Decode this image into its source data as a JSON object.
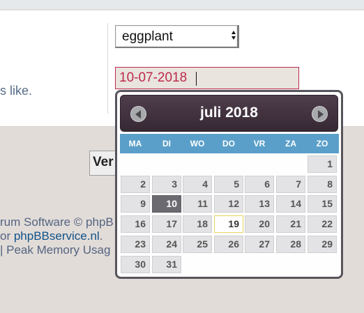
{
  "form": {
    "select": {
      "value": "eggplant"
    },
    "date_input": {
      "value": "10-07-2018"
    },
    "label_fragment": "s like.",
    "submit_label": "Ver"
  },
  "footer": {
    "line1": "rum Software © phpB",
    "line2_prefix": "or ",
    "line2_link": "phpBBservice.nl",
    "line2_suffix": ".",
    "line3": "| Peak Memory Usag"
  },
  "datepicker": {
    "month_title": "juli 2018",
    "weekdays": [
      "MA",
      "DI",
      "WO",
      "DO",
      "VR",
      "ZA",
      "ZO"
    ],
    "days": [
      1,
      2,
      3,
      4,
      5,
      6,
      7,
      8,
      9,
      10,
      11,
      12,
      13,
      14,
      15,
      16,
      17,
      18,
      19,
      20,
      21,
      22,
      23,
      24,
      25,
      26,
      27,
      28,
      29,
      30,
      31
    ],
    "first_weekday_index": 6,
    "selected_day": 10,
    "today_day": 19
  },
  "colors": {
    "accent_error": "#bc2a4d",
    "header_dark": "#3f2f3c",
    "weekday_bar": "#5a9fc9",
    "link": "#105289"
  },
  "icons": {
    "prev": "chevron-left-circle",
    "next": "chevron-right-circle",
    "select": "updown-arrows"
  }
}
